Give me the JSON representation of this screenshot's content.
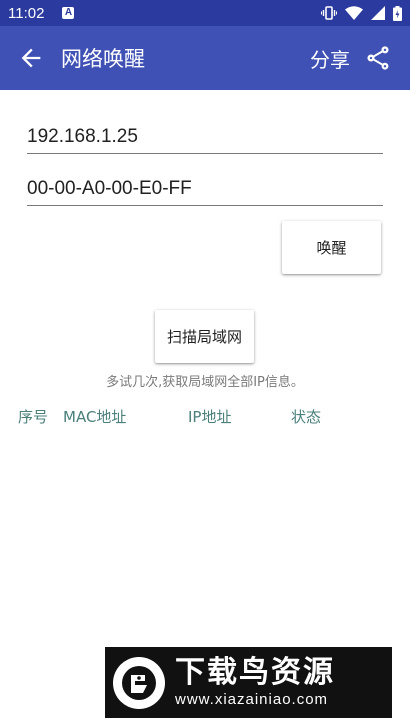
{
  "status_bar": {
    "time": "11:02",
    "app_icon_letter": "A"
  },
  "app_bar": {
    "title": "网络唤醒",
    "share_label": "分享"
  },
  "form": {
    "ip_value": "192.168.1.25",
    "mac_value": "00-00-A0-00-E0-FF",
    "wake_button": "唤醒",
    "scan_button": "扫描局域网",
    "hint": "多试几次,获取局域网全部IP信息。"
  },
  "table": {
    "columns": [
      "序号",
      "MAC地址",
      "IP地址",
      "状态"
    ]
  },
  "watermark": {
    "brand": "下载鸟资源",
    "url": "www.xiazainiao.com"
  },
  "colors": {
    "app_bar": "#3f51b5",
    "status_bar": "#2b3a9f",
    "table_header": "#4a7f7b"
  }
}
